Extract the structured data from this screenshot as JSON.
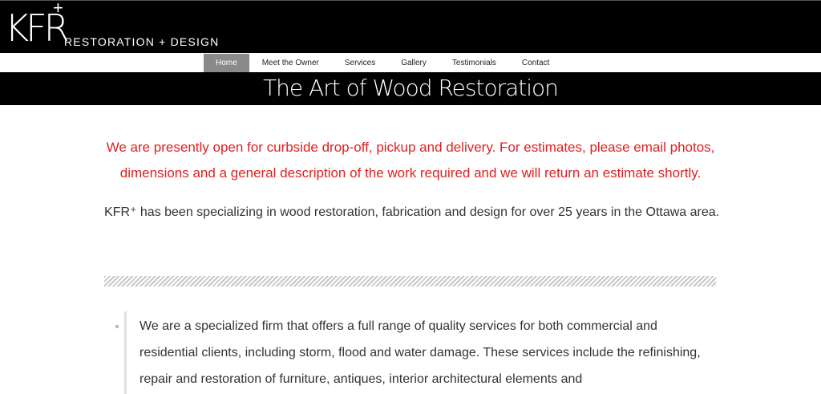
{
  "logo": {
    "main": "KFR",
    "plus": "+",
    "sub": "RESTORATION + DESIGN"
  },
  "nav": {
    "items": [
      "Home",
      "Meet the Owner",
      "Services",
      "Gallery",
      "Testimonials",
      "Contact"
    ],
    "active": "Home"
  },
  "banner": {
    "title": "The Art of Wood Restoration"
  },
  "notice": {
    "text": "We are presently open for curbside drop-off, pickup and delivery. For estimates, please email photos, dimensions and a general description of the work required and we will return an estimate shortly."
  },
  "intro": {
    "text": "KFR⁺ has been specializing in wood restoration, fabrication and design for over 25 years in the Ottawa area."
  },
  "services_list": {
    "items": [
      "We are a specialized firm that offers a full range of quality services for both commercial and residential clients, including storm, flood and water damage. These services include the refinishing, repair and restoration of furniture, antiques, interior architectural elements and"
    ]
  },
  "colors": {
    "header_bg": "#000000",
    "notice": "#e02020",
    "nav_active_bg": "#8a8a8a"
  }
}
